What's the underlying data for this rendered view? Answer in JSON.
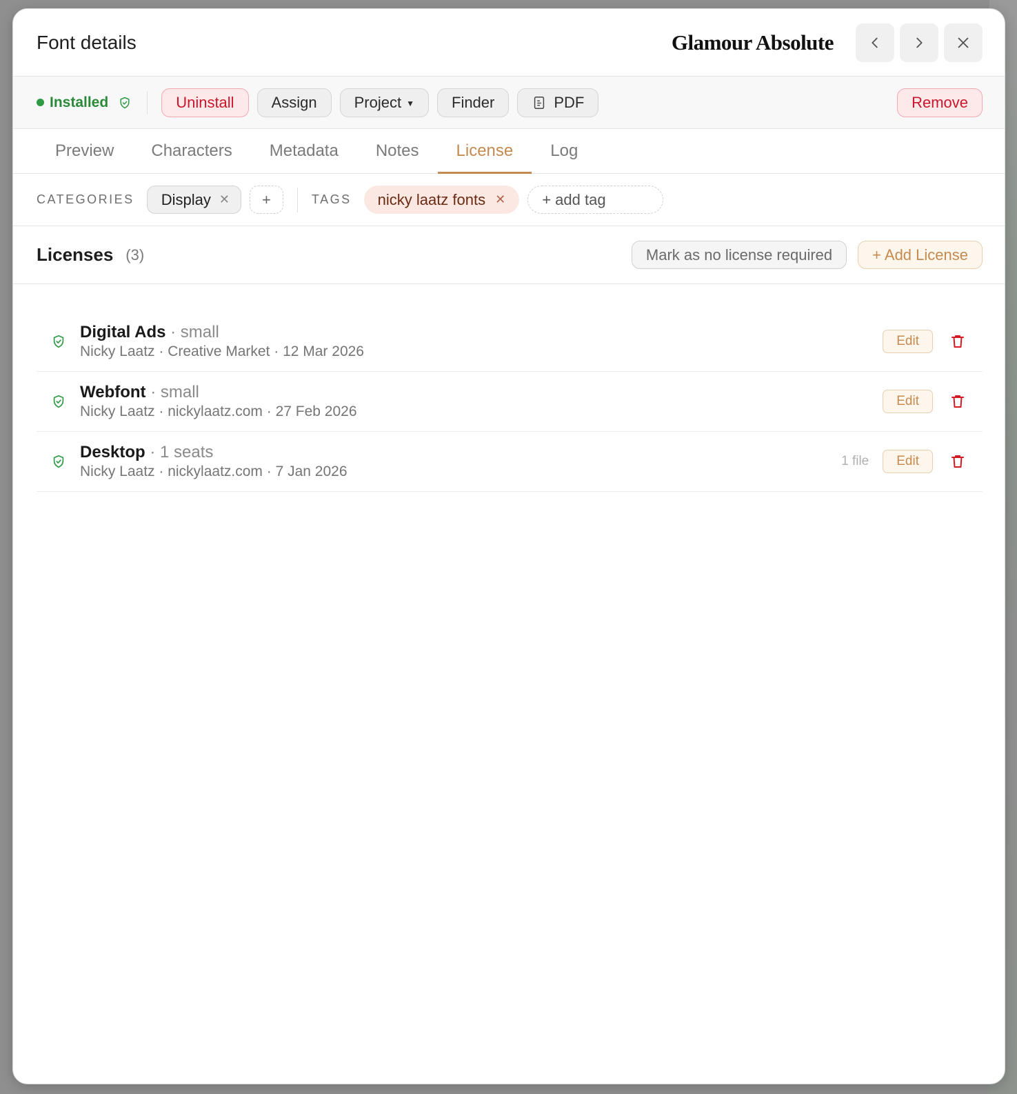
{
  "header": {
    "title": "Font details",
    "font_name": "Glamour Absolute"
  },
  "actionbar": {
    "status": "Installed",
    "uninstall": "Uninstall",
    "assign": "Assign",
    "project": "Project",
    "finder": "Finder",
    "pdf": "PDF",
    "remove": "Remove"
  },
  "tabs": [
    {
      "label": "Preview"
    },
    {
      "label": "Characters"
    },
    {
      "label": "Metadata"
    },
    {
      "label": "Notes"
    },
    {
      "label": "License",
      "active": true
    },
    {
      "label": "Log"
    }
  ],
  "categories": {
    "label": "CATEGORIES",
    "items": [
      "Display"
    ],
    "add": "+"
  },
  "tags": {
    "label": "TAGS",
    "items": [
      "nicky laatz fonts"
    ],
    "add_placeholder": "+ add tag"
  },
  "licenses": {
    "title": "Licenses",
    "count": "(3)",
    "mark_no_license": "Mark as no license required",
    "add_license": "+ Add License",
    "items": [
      {
        "name": "Digital Ads",
        "detail": " · small",
        "meta": "Nicky Laatz · Creative Market · 12 Mar 2026",
        "files": "",
        "edit": "Edit"
      },
      {
        "name": "Webfont",
        "detail": " · small",
        "meta": "Nicky Laatz · nickylaatz.com · 27 Feb 2026",
        "files": "",
        "edit": "Edit"
      },
      {
        "name": "Desktop",
        "detail": " · 1 seats",
        "meta": "Nicky Laatz · nickylaatz.com · 7 Jan 2026",
        "files": "1 file",
        "edit": "Edit"
      }
    ]
  },
  "colors": {
    "accent": "#c58a4f",
    "installed_green": "#2e9a45",
    "danger_red": "#c9182b",
    "tag_bg": "#fbe8e2"
  },
  "icons": {
    "prev": "chevron-left-icon",
    "next": "chevron-right-icon",
    "close": "close-icon",
    "shield": "shield-check-icon",
    "pdf": "document-icon",
    "trash": "trash-icon"
  }
}
